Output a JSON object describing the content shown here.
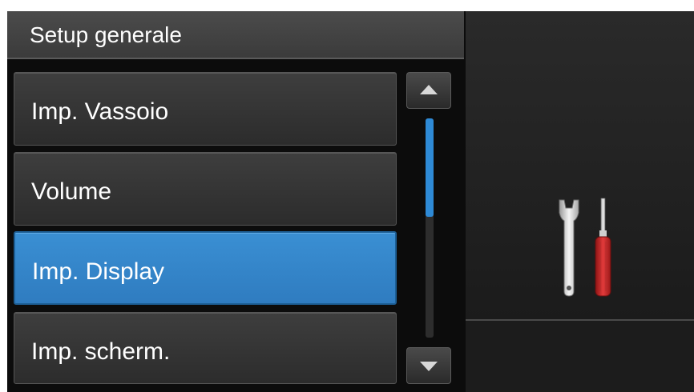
{
  "header": {
    "title": "Setup generale"
  },
  "menu": {
    "items": [
      {
        "label": "Imp. Vassoio",
        "selected": false
      },
      {
        "label": "Volume",
        "selected": false
      },
      {
        "label": "Imp. Display",
        "selected": true
      },
      {
        "label": "Imp. scherm.",
        "selected": false
      }
    ]
  },
  "scrollbar": {
    "position_fraction": 0.0,
    "visible_fraction": 0.45
  },
  "icons": {
    "scroll_up": "triangle-up-icon",
    "scroll_down": "triangle-down-icon",
    "panel": "tools-icon"
  },
  "colors": {
    "accent": "#2e86d1",
    "background": "#0c0c0c",
    "item": "#333333"
  }
}
